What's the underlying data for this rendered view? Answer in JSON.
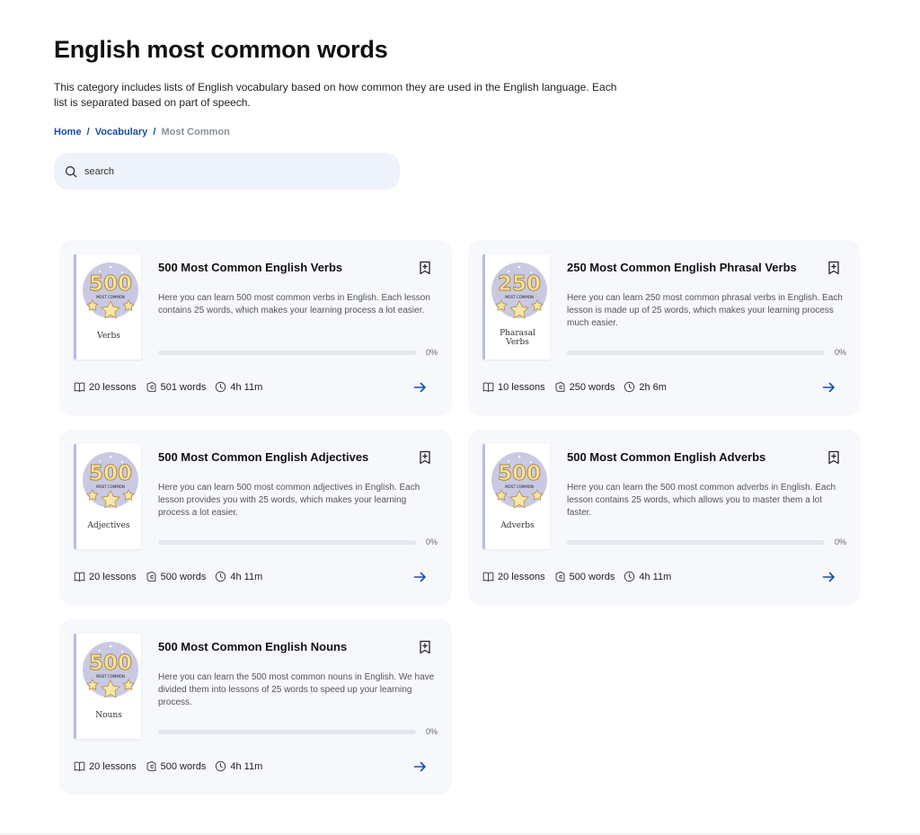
{
  "header": {
    "title": "English most common words",
    "description": "This category includes lists of English vocabulary based on how common they are used in the English language. Each list is separated based on part of speech."
  },
  "breadcrumb": {
    "home": "Home",
    "separator": "/",
    "vocabulary": "Vocabulary",
    "current": "Most Common"
  },
  "search": {
    "placeholder": "search"
  },
  "colors": {
    "accent": "#1a4ea8",
    "card_bg": "#f6f8fc",
    "cover_circle": "#c9c9e3",
    "cover_number": "#f5e2a0"
  },
  "cards": [
    {
      "cover_number": "500",
      "cover_badge": "MOST COMMON",
      "cover_label": "Verbs",
      "title": "500 Most Common English Verbs",
      "description": "Here you can learn 500 most common verbs in English. Each lesson contains 25 words, which makes your learning process a lot easier.",
      "progress": 0,
      "progress_label": "0%",
      "lessons": "20 lessons",
      "words": "501 words",
      "duration": "4h 11m"
    },
    {
      "cover_number": "250",
      "cover_badge": "MOST COMMON",
      "cover_label": "Pharasal Verbs",
      "title": "250 Most Common English Phrasal Verbs",
      "description": "Here you can learn 250 most common phrasal verbs in English. Each lesson is made up of 25 words, which makes your learning process much easier.",
      "progress": 0,
      "progress_label": "0%",
      "lessons": "10 lessons",
      "words": "250 words",
      "duration": "2h 6m"
    },
    {
      "cover_number": "500",
      "cover_badge": "MOST COMMON",
      "cover_label": "Adjectives",
      "title": "500 Most Common English Adjectives",
      "description": "Here you can learn 500 most common adjectives in English. Each lesson provides you with 25 words, which makes your learning process a lot easier.",
      "progress": 0,
      "progress_label": "0%",
      "lessons": "20 lessons",
      "words": "500 words",
      "duration": "4h 11m"
    },
    {
      "cover_number": "500",
      "cover_badge": "MOST COMMON",
      "cover_label": "Adverbs",
      "title": "500 Most Common English Adverbs",
      "description": "Here you can learn the 500 most common adverbs in English. Each lesson contains 25 words, which allows you to master them a lot faster.",
      "progress": 0,
      "progress_label": "0%",
      "lessons": "20 lessons",
      "words": "500 words",
      "duration": "4h 11m"
    },
    {
      "cover_number": "500",
      "cover_badge": "MOST COMMON",
      "cover_label": "Nouns",
      "title": "500 Most Common English Nouns",
      "description": "Here you can learn the 500 most common nouns in English. We have divided them into lessons of 25 words to speed up your learning process.",
      "progress": 0,
      "progress_label": "0%",
      "lessons": "20 lessons",
      "words": "500 words",
      "duration": "4h 11m"
    }
  ],
  "icons": {
    "search": "search-icon",
    "bookmark": "bookmark-add-icon",
    "lessons": "book-open-icon",
    "words": "words-icon",
    "duration": "clock-icon",
    "go": "arrow-right-icon"
  }
}
